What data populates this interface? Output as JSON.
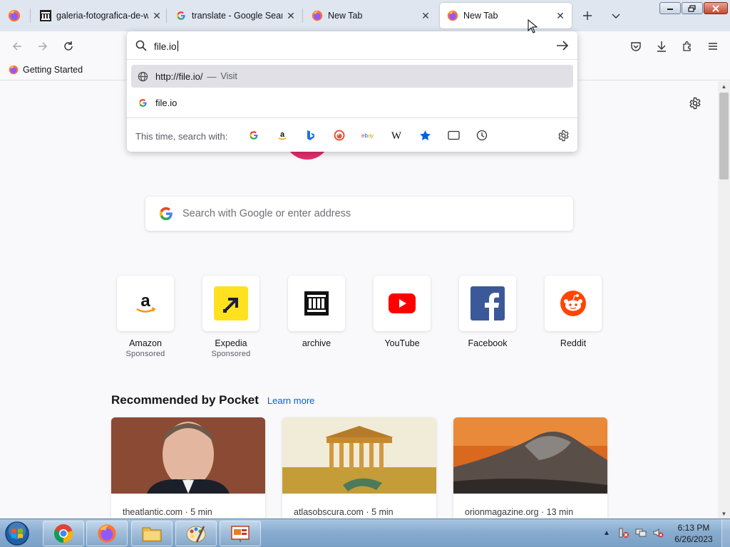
{
  "tabs": [
    {
      "title": "galeria-fotografica-de-w",
      "icon": "archive-icon",
      "active": false
    },
    {
      "title": "translate - Google Search",
      "icon": "google-icon",
      "active": false
    },
    {
      "title": "New Tab",
      "icon": "firefox-icon",
      "active": false
    },
    {
      "title": "New Tab",
      "icon": "firefox-icon",
      "active": true
    }
  ],
  "toolbar": {
    "new_tab_icon": "plus-icon",
    "list_all_tabs_icon": "chevron-down-icon"
  },
  "urlbar": {
    "value": "file.io",
    "results": [
      {
        "text": "http://file.io/",
        "separator": "—",
        "action": "Visit",
        "icon": "globe-icon",
        "selected": true
      },
      {
        "text": "file.io",
        "icon": "google-icon",
        "selected": false
      }
    ],
    "oneoff_label": "This time, search with:",
    "oneoff_engines": [
      "google-icon",
      "amazon-icon",
      "bing-icon",
      "duckduckgo-icon",
      "ebay-icon",
      "wikipedia-icon",
      "bookmarks-star-icon",
      "tabs-icon",
      "history-clock-icon"
    ]
  },
  "bookmarks": [
    {
      "label": "Getting Started",
      "icon": "firefox-icon"
    }
  ],
  "newtab": {
    "search_placeholder": "Search with Google or enter address",
    "shortcuts": [
      {
        "name": "Amazon",
        "sponsored": "Sponsored",
        "icon": "amazon-icon"
      },
      {
        "name": "Expedia",
        "sponsored": "Sponsored",
        "icon": "expedia-icon"
      },
      {
        "name": "archive",
        "sponsored": "",
        "icon": "archive-icon"
      },
      {
        "name": "YouTube",
        "sponsored": "",
        "icon": "youtube-icon"
      },
      {
        "name": "Facebook",
        "sponsored": "",
        "icon": "facebook-icon"
      },
      {
        "name": "Reddit",
        "sponsored": "",
        "icon": "reddit-icon"
      }
    ],
    "pocket_title": "Recommended by Pocket",
    "pocket_learn_more": "Learn more",
    "stories": [
      {
        "source": "theatlantic.com · 5 min"
      },
      {
        "source": "atlasobscura.com · 5 min"
      },
      {
        "source": "orionmagazine.org · 13 min"
      }
    ]
  },
  "taskbar": {
    "apps": [
      "chrome-icon",
      "firefox-icon",
      "file-explorer-icon",
      "paint-icon",
      "presentation-icon"
    ],
    "time": "6:13 PM",
    "date": "6/26/2023"
  },
  "colors": {
    "accent": "#0061e0",
    "tabstrip": "#dfe6f0",
    "selected_row": "#e0e0e6"
  }
}
